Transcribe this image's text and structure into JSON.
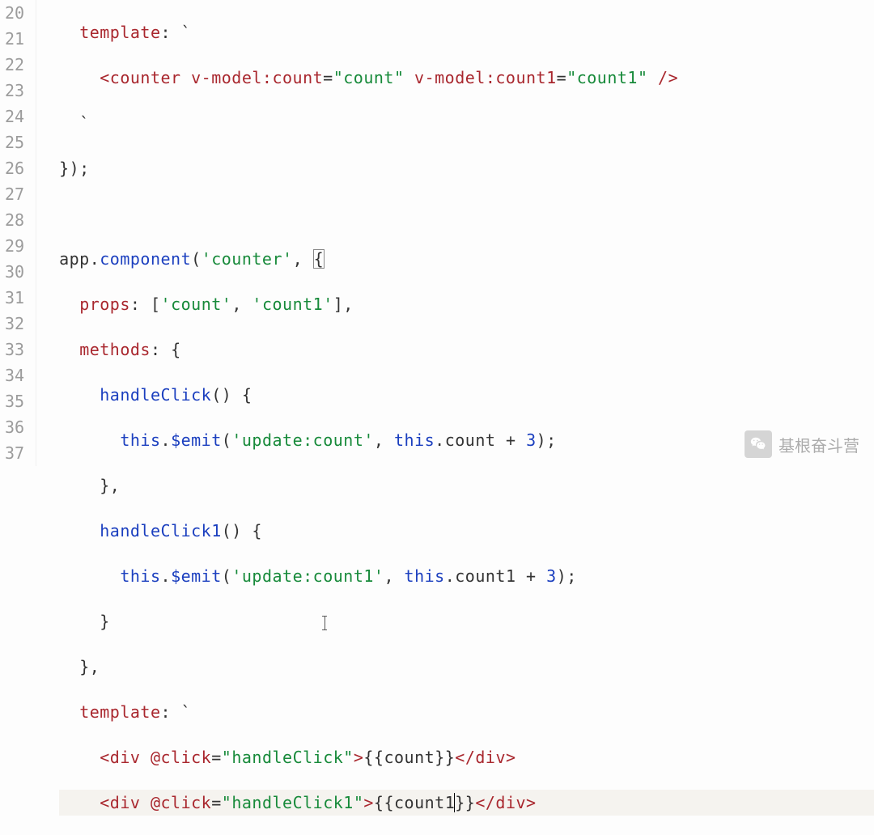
{
  "lineNumbers": [
    "20",
    "21",
    "22",
    "23",
    "24",
    "25",
    "26",
    "27",
    "28",
    "29",
    "30",
    "31",
    "32",
    "33",
    "34",
    "35",
    "36",
    "37"
  ],
  "code": {
    "l20_key": "template",
    "l21_counter": "<counter",
    "l21_attr1": " v-model:count",
    "l21_eq": "=",
    "l21_val1": "\"count\"",
    "l21_attr2": " v-model:count1",
    "l21_val2": "\"count1\"",
    "l21_close": " />",
    "l22_tick": "`",
    "l23_close": "});",
    "l25_app": "app",
    "l25_dot": ".",
    "l25_component": "component",
    "l25_open": "(",
    "l25_name": "'counter'",
    "l25_comma": ", ",
    "l25_brace": "{",
    "l26_props": "props",
    "l26_colon": ": [",
    "l26_count": "'count'",
    "l26_sep": ", ",
    "l26_count1": "'count1'",
    "l26_close": "],",
    "l27_methods": "methods",
    "l27_colon": ": {",
    "l28_name": "handleClick",
    "l28_par": "() {",
    "l29_this": "this",
    "l29_dot": ".",
    "l29_emit": "$emit",
    "l29_open": "(",
    "l29_event": "'update:count'",
    "l29_sep": ", ",
    "l29_this2": "this",
    "l29_dot2": ".",
    "l29_prop": "count",
    "l29_plus": " + ",
    "l29_num": "3",
    "l29_close": ");",
    "l30_close": "},",
    "l31_name": "handleClick1",
    "l31_par": "() {",
    "l32_this": "this",
    "l32_dot": ".",
    "l32_emit": "$emit",
    "l32_open": "(",
    "l32_event": "'update:count1'",
    "l32_sep": ", ",
    "l32_this2": "this",
    "l32_dot2": ".",
    "l32_prop": "count1",
    "l32_plus": " + ",
    "l32_num": "3",
    "l32_close": ");",
    "l33_close": "}",
    "l34_close": "},",
    "l35_key": "template",
    "l35_tick": ": `",
    "l36_open": "<div",
    "l36_attr": " @click",
    "l36_eq": "=",
    "l36_val": "\"handleClick\"",
    "l36_gt": ">",
    "l36_mo": "{{",
    "l36_expr": "count",
    "l36_mc": "}}",
    "l36_close": "</div>",
    "l37_open": "<div",
    "l37_attr": " @click",
    "l37_eq": "=",
    "l37_val": "\"handleClick1\"",
    "l37_gt": ">",
    "l37_mo": "{{",
    "l37_expr_a": "count1",
    "l37_mc": "}}",
    "l37_close": "</div>"
  },
  "watermark": {
    "text": "基根奋斗营"
  }
}
